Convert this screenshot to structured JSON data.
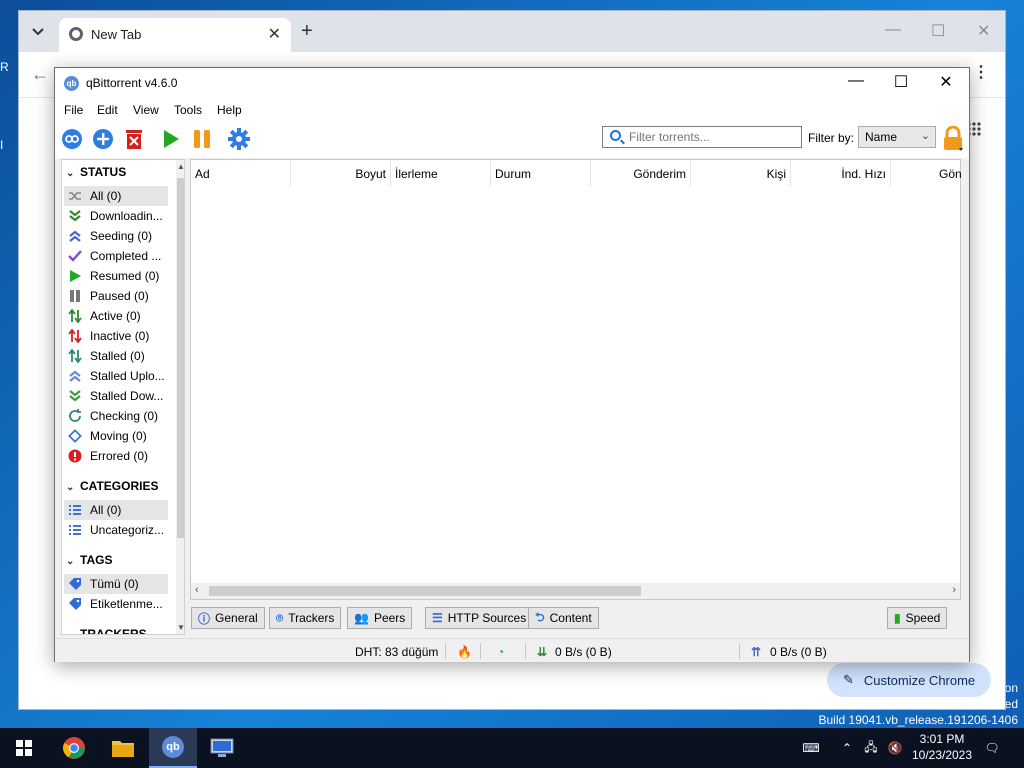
{
  "desktop": {
    "edge_letters": [
      "R",
      "I"
    ],
    "watermark_lines": [
      "on",
      "ed",
      "Build 19041.vb_release.191206-1406"
    ]
  },
  "chrome": {
    "tab_title": "New Tab",
    "customize_label": "Customize Chrome"
  },
  "qb": {
    "title": "qBittorrent v4.6.0",
    "menu": [
      "File",
      "Edit",
      "View",
      "Tools",
      "Help"
    ],
    "filter_placeholder": "Filter torrents...",
    "filter_by_label": "Filter by:",
    "filter_by_value": "Name",
    "status_header": "STATUS",
    "status_items": [
      {
        "label": "All (0)",
        "icon": "shuffle-icon",
        "color": "#888888"
      },
      {
        "label": "Downloadin...",
        "icon": "double-chevron-down-icon",
        "color": "#2e8b2e"
      },
      {
        "label": "Seeding (0)",
        "icon": "double-chevron-up-icon",
        "color": "#4a67c8"
      },
      {
        "label": "Completed ...",
        "icon": "checkmark-icon",
        "color": "#7b4fc9"
      },
      {
        "label": "Resumed (0)",
        "icon": "play-icon",
        "color": "#22a822"
      },
      {
        "label": "Paused (0)",
        "icon": "pause-icon",
        "color": "#777777"
      },
      {
        "label": "Active (0)",
        "icon": "arrows-updown-icon",
        "color": "#2e8b2e"
      },
      {
        "label": "Inactive (0)",
        "icon": "arrows-updown-red-icon",
        "color": "#d62020"
      },
      {
        "label": "Stalled (0)",
        "icon": "arrows-updown-stalled-icon",
        "color": "#2a8a7a"
      },
      {
        "label": "Stalled Uplo...",
        "icon": "stalled-up-icon",
        "color": "#6b88d8"
      },
      {
        "label": "Stalled Dow...",
        "icon": "stalled-down-icon",
        "color": "#3a9a3a"
      },
      {
        "label": "Checking (0)",
        "icon": "refresh-icon",
        "color": "#2e8b6e"
      },
      {
        "label": "Moving (0)",
        "icon": "move-icon",
        "color": "#3a7ad0"
      },
      {
        "label": "Errored (0)",
        "icon": "error-icon",
        "color": "#d61e1e"
      }
    ],
    "categories_header": "CATEGORIES",
    "category_items": [
      {
        "label": "All (0)",
        "icon": "list-icon",
        "color": "#3a74d0"
      },
      {
        "label": "Uncategoriz...",
        "icon": "list-icon",
        "color": "#3a74d0"
      }
    ],
    "tags_header": "TAGS",
    "tag_items": [
      {
        "label": "Tümü (0)",
        "icon": "tag-icon",
        "color": "#2f6bd6"
      },
      {
        "label": "Etiketlenme...",
        "icon": "tag-icon",
        "color": "#2f6bd6"
      }
    ],
    "trackers_header": "TRACKERS",
    "columns": [
      "Ad",
      "Boyut",
      "İlerleme",
      "Durum",
      "Gönderim",
      "Kişi",
      "İnd. Hızı",
      "Gön"
    ],
    "bottom_tabs": [
      {
        "label": "General",
        "icon": "info-icon"
      },
      {
        "label": "Trackers",
        "icon": "pin-icon"
      },
      {
        "label": "Peers",
        "icon": "people-icon"
      },
      {
        "label": "HTTP Sources",
        "icon": "database-icon"
      },
      {
        "label": "Content",
        "icon": "content-icon"
      }
    ],
    "speed_tab": "Speed",
    "status": {
      "dht": "DHT: 83 düğüm",
      "download": "0 B/s (0 B)",
      "upload": "0 B/s (0 B)"
    }
  },
  "taskbar": {
    "time": "3:01 PM",
    "date": "10/23/2023"
  }
}
